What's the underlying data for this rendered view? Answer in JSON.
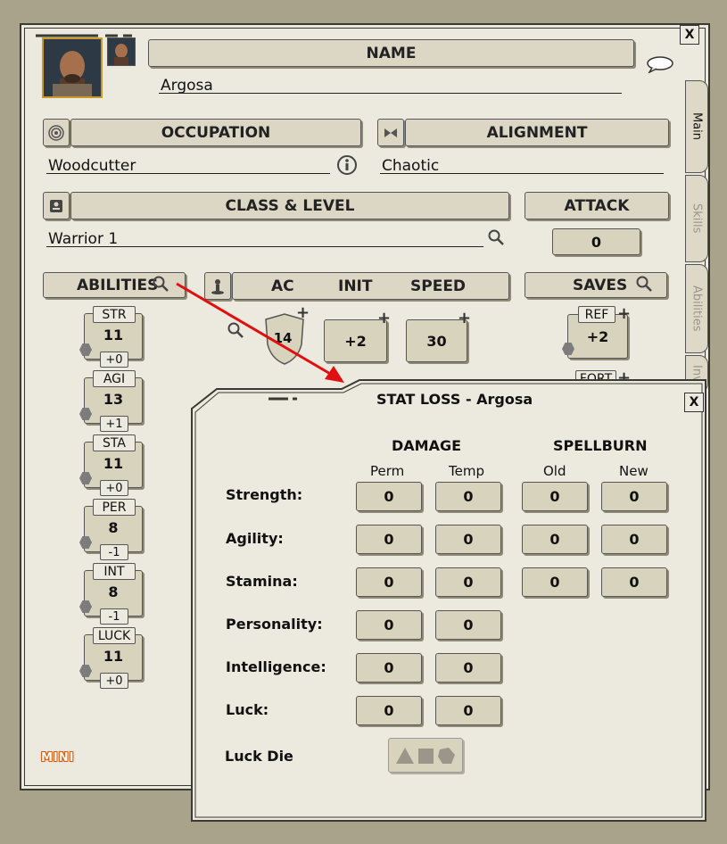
{
  "main_window": {
    "close_label": "X",
    "name": {
      "header": "NAME",
      "value": "Argosa"
    },
    "occupation": {
      "header": "OCCUPATION",
      "value": "Woodcutter"
    },
    "alignment": {
      "header": "ALIGNMENT",
      "value": "Chaotic"
    },
    "class_level": {
      "header": "CLASS & LEVEL",
      "value": "Warrior 1"
    },
    "attack": {
      "header": "ATTACK",
      "value": "0"
    },
    "abilities": {
      "header": "ABILITIES",
      "items": [
        {
          "label": "STR",
          "score": "11",
          "mod": "+0"
        },
        {
          "label": "AGI",
          "score": "13",
          "mod": "+1"
        },
        {
          "label": "STA",
          "score": "11",
          "mod": "+0"
        },
        {
          "label": "PER",
          "score": "8",
          "mod": "-1"
        },
        {
          "label": "INT",
          "score": "8",
          "mod": "-1"
        },
        {
          "label": "LUCK",
          "score": "11",
          "mod": "+0"
        }
      ]
    },
    "combat": {
      "ac_label": "AC",
      "init_label": "INIT",
      "speed_label": "SPEED",
      "ac_value": "14",
      "init_value": "+2",
      "speed_value": "30"
    },
    "saves": {
      "header": "SAVES",
      "ref_label": "REF",
      "ref_value": "+2",
      "fort_label": "FORT"
    },
    "tabs": [
      "Main",
      "Skills",
      "Abilities",
      "Inv"
    ],
    "mini_label": "MINI"
  },
  "stat_loss_window": {
    "title": "STAT LOSS - Argosa",
    "close_label": "X",
    "damage_header": "DAMAGE",
    "spellburn_header": "SPELLBURN",
    "col_perm": "Perm",
    "col_temp": "Temp",
    "col_old": "Old",
    "col_new": "New",
    "rows": [
      {
        "label": "Strength:",
        "perm": "0",
        "temp": "0",
        "old": "0",
        "new": "0"
      },
      {
        "label": "Agility:",
        "perm": "0",
        "temp": "0",
        "old": "0",
        "new": "0"
      },
      {
        "label": "Stamina:",
        "perm": "0",
        "temp": "0",
        "old": "0",
        "new": "0"
      },
      {
        "label": "Personality:",
        "perm": "0",
        "temp": "0"
      },
      {
        "label": "Intelligence:",
        "perm": "0",
        "temp": "0"
      },
      {
        "label": "Luck:",
        "perm": "0",
        "temp": "0"
      }
    ],
    "luck_die_label": "Luck Die"
  },
  "colors": {
    "desktop": "#a8a38a",
    "panel": "#ece9df",
    "field": "#dcd7c4",
    "arrow": "#e01010"
  }
}
